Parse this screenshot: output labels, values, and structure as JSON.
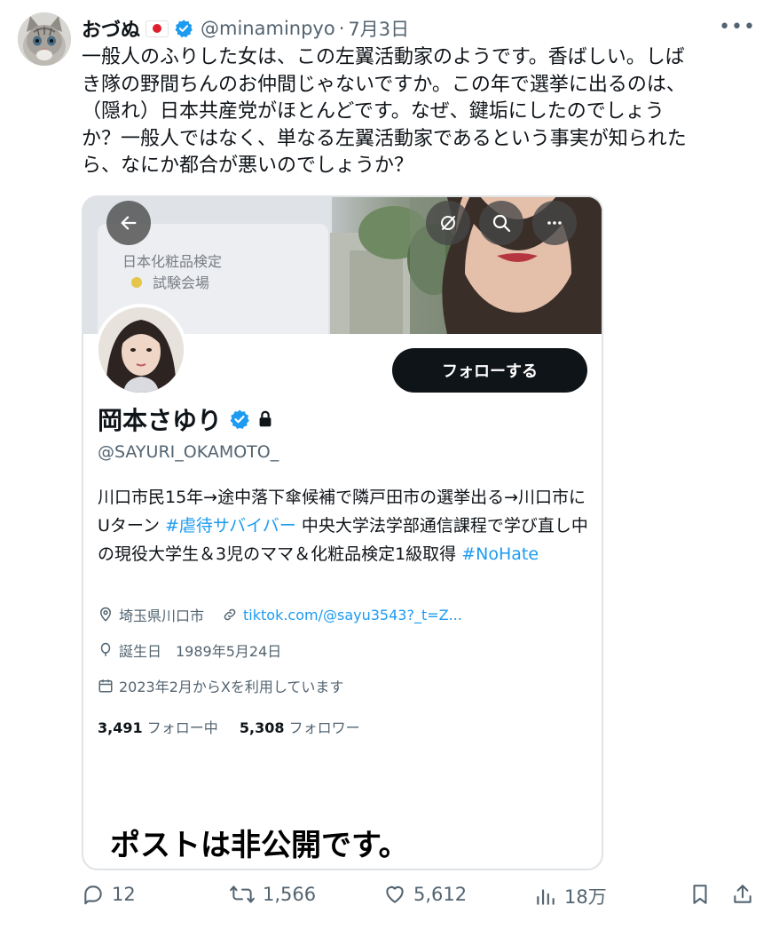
{
  "tweet": {
    "author_name": "おづぬ",
    "author_handle": "@minaminpyo",
    "separator": "·",
    "date": "7月3日",
    "text": "一般人のふりした女は、この左翼活動家のようです。香ばしい。しば\nき隊の野間ちんのお仲間じゃないですか。この年で選挙に出るのは、\n（隠れ）日本共産党がほとんどです。なぜ、鍵垢にしたのでしょう\nか？一般人ではなく、単なる左翼活動家であるという事実が知られた\nら、なにか都合が悪いのでしょうか？",
    "more_icon": "more-horizontal-icon"
  },
  "embedded_profile": {
    "banner_text": [
      "日本化粧品検定",
      "試験会場"
    ],
    "follow_label": "フォローする",
    "display_name": "岡本さゆり",
    "handle": "@SAYURI_OKAMOTO_",
    "bio": {
      "part1": "川口市民15年→途中落下傘候補で隣戸田市の選挙出る→川口市にUターン ",
      "hashtag1": "#虐待サバイバー",
      "part2": " 中央大学法学部通信課程で学び直し中の現役大学生＆3児のママ＆化粧品検定1級取得 ",
      "hashtag2": "#NoHate"
    },
    "location": "埼玉県川口市",
    "link": "tiktok.com/@sayu3543?_t=Z...",
    "birthday": "誕生日　1989年5月24日",
    "joined": "2023年2月からXを利用しています",
    "following_count": "3,491",
    "following_label": "フォロー中",
    "followers_count": "5,308",
    "followers_label": "フォロワー",
    "private_notice": "ポストは非公開です。"
  },
  "actions": {
    "replies": "12",
    "reposts": "1,566",
    "likes": "5,612",
    "views": "18万"
  },
  "colors": {
    "accent": "#1d9bf0",
    "text": "#0f1419",
    "muted": "#536471",
    "follow_button": "#0f1419"
  }
}
